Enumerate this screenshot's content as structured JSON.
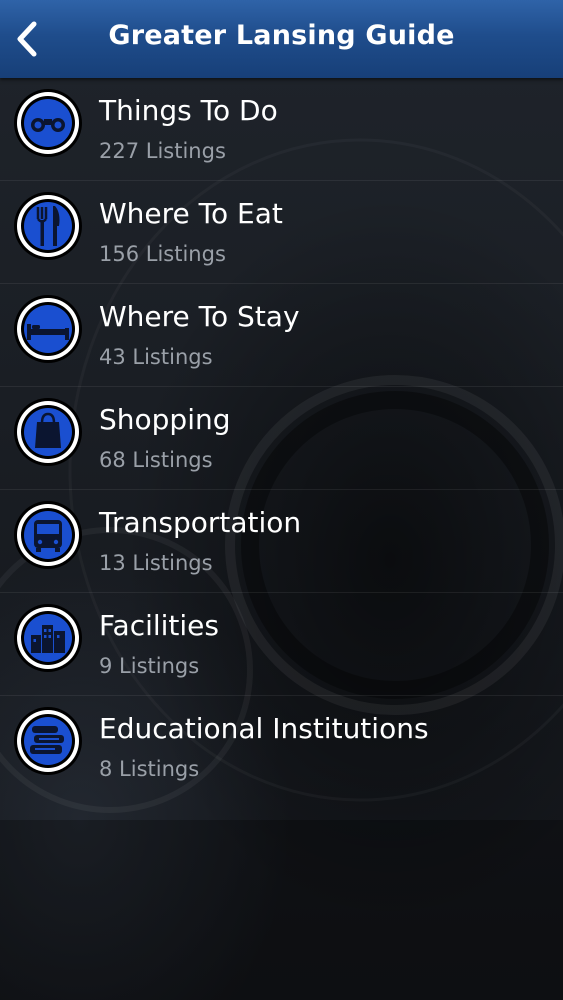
{
  "header": {
    "title": "Greater Lansing Guide",
    "back_icon": "chevron-left-icon"
  },
  "colors": {
    "navbar": "#1f4d8c",
    "icon_fill": "#1a4fd0",
    "subtitle": "#9aa0a8"
  },
  "categories": [
    {
      "title": "Things To Do",
      "subtitle": "227 Listings",
      "icon": "binoculars-icon"
    },
    {
      "title": "Where To Eat",
      "subtitle": "156 Listings",
      "icon": "fork-knife-icon"
    },
    {
      "title": "Where To Stay",
      "subtitle": "43 Listings",
      "icon": "bed-icon"
    },
    {
      "title": "Shopping",
      "subtitle": "68 Listings",
      "icon": "shopping-bag-icon"
    },
    {
      "title": "Transportation",
      "subtitle": "13 Listings",
      "icon": "bus-icon"
    },
    {
      "title": "Facilities",
      "subtitle": "9 Listings",
      "icon": "buildings-icon"
    },
    {
      "title": "Educational Institutions",
      "subtitle": "8 Listings",
      "icon": "books-icon"
    }
  ]
}
